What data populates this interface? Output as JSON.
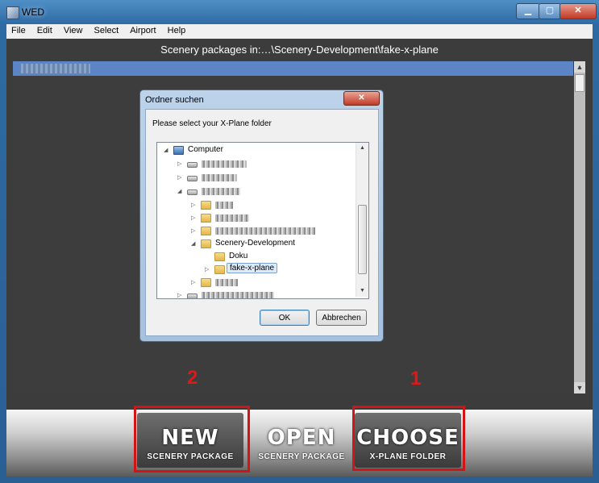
{
  "window": {
    "title": "WED"
  },
  "menu": [
    "File",
    "Edit",
    "View",
    "Select",
    "Airport",
    "Help"
  ],
  "header": {
    "text": "Scenery packages in:…\\Scenery-Development\\fake-x-plane"
  },
  "toolbar": {
    "new": {
      "main": "NEW",
      "sub": "SCENERY PACKAGE"
    },
    "open": {
      "main": "OPEN",
      "sub": "SCENERY PACKAGE"
    },
    "choose": {
      "main": "CHOOSE",
      "sub": "X-PLANE FOLDER"
    }
  },
  "annotations": {
    "marker_new": "2",
    "marker_choose": "1",
    "color": "#d41414"
  },
  "dialog": {
    "title": "Ordner suchen",
    "close": "✕",
    "prompt": "Please select your X-Plane folder",
    "ok": "OK",
    "cancel": "Abbrechen",
    "tree": {
      "computer": "Computer",
      "scenery_dev": "Scenery-Development",
      "doku": "Doku",
      "fake_xplane": "fake-x-plane"
    }
  },
  "icons": {
    "app": "wed-app-icon",
    "folder": "folder-icon",
    "computer": "computer-icon",
    "drive": "drive-icon"
  }
}
